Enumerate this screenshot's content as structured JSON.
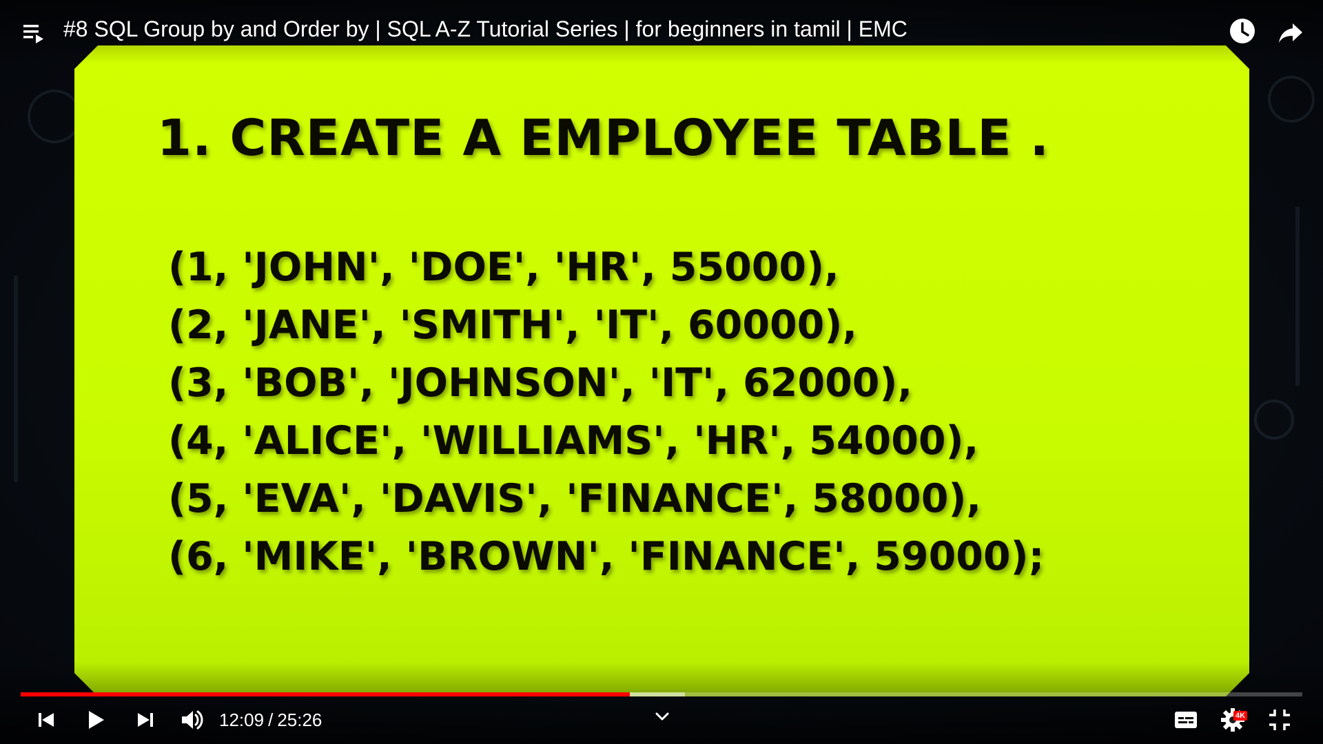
{
  "header": {
    "title": "#8 SQL Group by and Order by | SQL A-Z Tutorial Series | for beginners in tamil | EMC"
  },
  "slide": {
    "heading": "1. CREATE A EMPLOYEE TABLE .",
    "rows": [
      "(1, 'JOHN', 'DOE', 'HR', 55000),",
      "(2, 'JANE', 'SMITH', 'IT', 60000),",
      "(3, 'BOB', 'JOHNSON', 'IT', 62000),",
      "(4, 'ALICE', 'WILLIAMS', 'HR', 54000),",
      "(5, 'EVA', 'DAVIS', 'FINANCE', 58000),",
      "(6, 'MIKE', 'BROWN', 'FINANCE', 59000);"
    ]
  },
  "player": {
    "current_time": "12:09",
    "separator": "/",
    "duration": "25:26",
    "played_fraction": 0.4755,
    "buffered_fraction": 0.5183,
    "quality_badge": "4K"
  },
  "colors": {
    "slide_background": "#ccff00",
    "progress_played": "#ff0000",
    "badge": "#ff0000"
  },
  "icons": {
    "playlist": "playlist-icon",
    "watch_later": "clock-icon",
    "share": "share-arrow-icon",
    "previous": "previous-icon",
    "play": "play-icon",
    "next": "next-icon",
    "volume": "volume-icon",
    "subtitles": "subtitles-icon",
    "settings": "gear-icon",
    "exit_fullscreen": "exit-fullscreen-icon",
    "expand": "chevron-down-icon"
  }
}
